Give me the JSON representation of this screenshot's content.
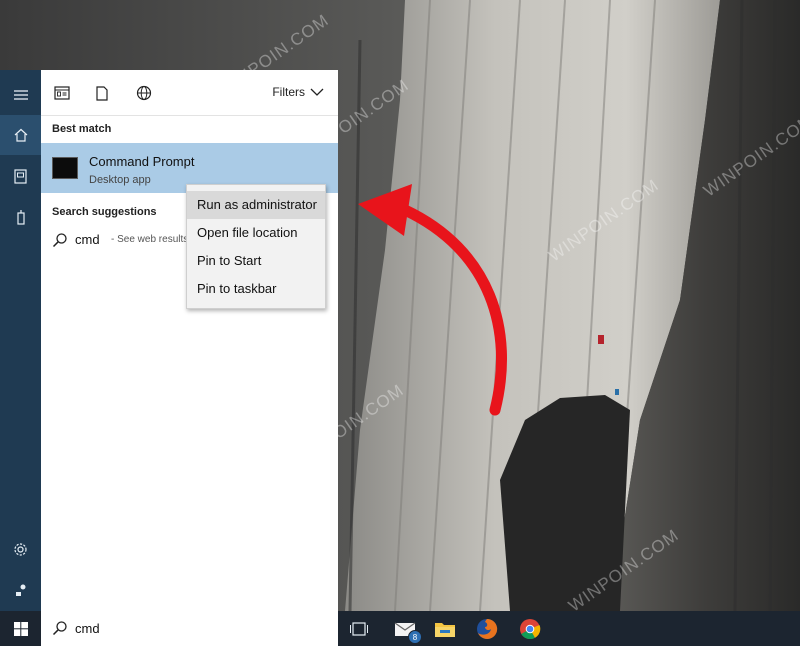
{
  "watermark": "WINPOIN.COM",
  "rail": {
    "items": [
      {
        "name": "hamburger-menu-icon"
      },
      {
        "name": "home-icon"
      },
      {
        "name": "documents-icon"
      },
      {
        "name": "device-icon"
      },
      {
        "name": "settings-icon"
      },
      {
        "name": "feedback-icon"
      }
    ]
  },
  "start_panel": {
    "top_icons": [
      "apps-filter-icon",
      "document-filter-icon",
      "web-filter-icon"
    ],
    "filters_label": "Filters",
    "best_match_title": "Best match",
    "best_match": {
      "title": "Command Prompt",
      "subtitle": "Desktop app"
    },
    "suggestions_title": "Search suggestions",
    "suggestion": {
      "term": "cmd",
      "hint": "- See web results"
    }
  },
  "context_menu": {
    "items": [
      {
        "label": "Run as administrator",
        "highlighted": true
      },
      {
        "label": "Open file location",
        "highlighted": false
      },
      {
        "label": "Pin to Start",
        "highlighted": false
      },
      {
        "label": "Pin to taskbar",
        "highlighted": false
      }
    ]
  },
  "taskbar": {
    "search_text": "cmd",
    "apps": [
      "task-view-icon",
      "mail-icon",
      "file-explorer-icon",
      "firefox-icon",
      "chrome-icon"
    ],
    "mail_badge": "8"
  },
  "colors": {
    "rail": "#1f3a52",
    "selection": "#aacbe6",
    "taskbar": "#1c2530",
    "arrow": "#e8141b"
  }
}
